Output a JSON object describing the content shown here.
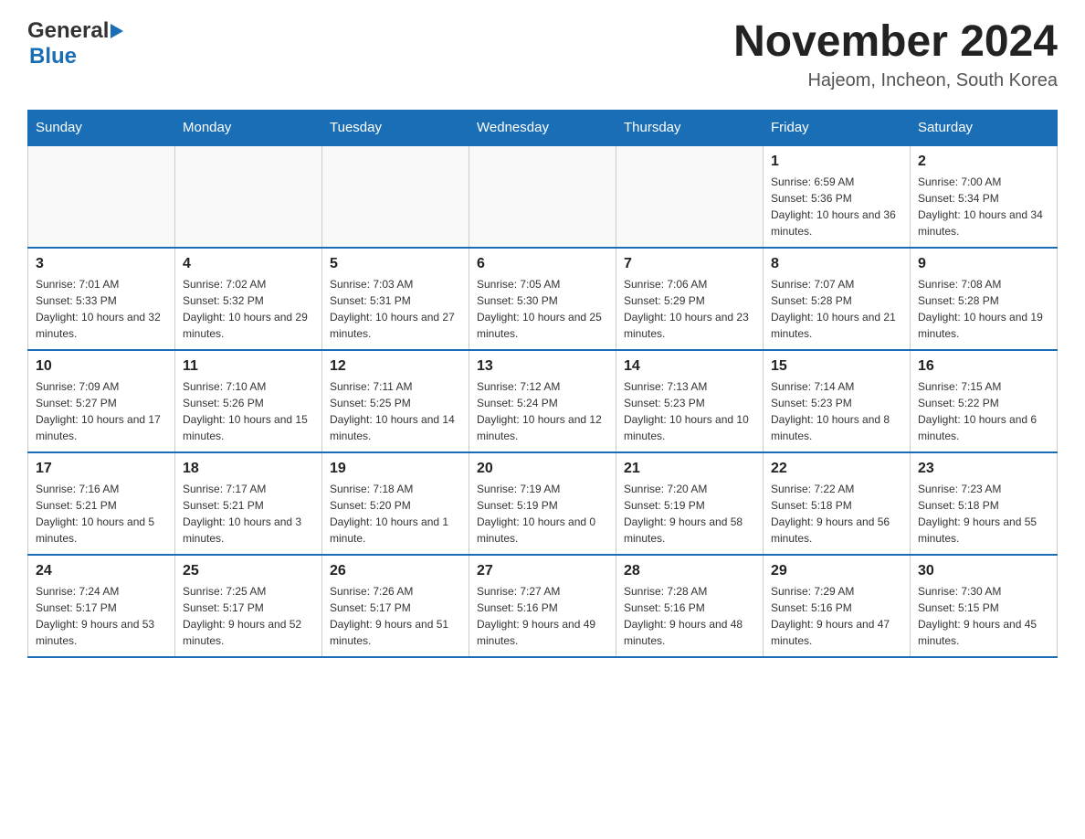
{
  "header": {
    "logo_general": "General",
    "logo_blue": "Blue",
    "title": "November 2024",
    "location": "Hajeom, Incheon, South Korea"
  },
  "days_of_week": [
    "Sunday",
    "Monday",
    "Tuesday",
    "Wednesday",
    "Thursday",
    "Friday",
    "Saturday"
  ],
  "weeks": [
    [
      {
        "day": "",
        "sunrise": "",
        "sunset": "",
        "daylight": ""
      },
      {
        "day": "",
        "sunrise": "",
        "sunset": "",
        "daylight": ""
      },
      {
        "day": "",
        "sunrise": "",
        "sunset": "",
        "daylight": ""
      },
      {
        "day": "",
        "sunrise": "",
        "sunset": "",
        "daylight": ""
      },
      {
        "day": "",
        "sunrise": "",
        "sunset": "",
        "daylight": ""
      },
      {
        "day": "1",
        "sunrise": "Sunrise: 6:59 AM",
        "sunset": "Sunset: 5:36 PM",
        "daylight": "Daylight: 10 hours and 36 minutes."
      },
      {
        "day": "2",
        "sunrise": "Sunrise: 7:00 AM",
        "sunset": "Sunset: 5:34 PM",
        "daylight": "Daylight: 10 hours and 34 minutes."
      }
    ],
    [
      {
        "day": "3",
        "sunrise": "Sunrise: 7:01 AM",
        "sunset": "Sunset: 5:33 PM",
        "daylight": "Daylight: 10 hours and 32 minutes."
      },
      {
        "day": "4",
        "sunrise": "Sunrise: 7:02 AM",
        "sunset": "Sunset: 5:32 PM",
        "daylight": "Daylight: 10 hours and 29 minutes."
      },
      {
        "day": "5",
        "sunrise": "Sunrise: 7:03 AM",
        "sunset": "Sunset: 5:31 PM",
        "daylight": "Daylight: 10 hours and 27 minutes."
      },
      {
        "day": "6",
        "sunrise": "Sunrise: 7:05 AM",
        "sunset": "Sunset: 5:30 PM",
        "daylight": "Daylight: 10 hours and 25 minutes."
      },
      {
        "day": "7",
        "sunrise": "Sunrise: 7:06 AM",
        "sunset": "Sunset: 5:29 PM",
        "daylight": "Daylight: 10 hours and 23 minutes."
      },
      {
        "day": "8",
        "sunrise": "Sunrise: 7:07 AM",
        "sunset": "Sunset: 5:28 PM",
        "daylight": "Daylight: 10 hours and 21 minutes."
      },
      {
        "day": "9",
        "sunrise": "Sunrise: 7:08 AM",
        "sunset": "Sunset: 5:28 PM",
        "daylight": "Daylight: 10 hours and 19 minutes."
      }
    ],
    [
      {
        "day": "10",
        "sunrise": "Sunrise: 7:09 AM",
        "sunset": "Sunset: 5:27 PM",
        "daylight": "Daylight: 10 hours and 17 minutes."
      },
      {
        "day": "11",
        "sunrise": "Sunrise: 7:10 AM",
        "sunset": "Sunset: 5:26 PM",
        "daylight": "Daylight: 10 hours and 15 minutes."
      },
      {
        "day": "12",
        "sunrise": "Sunrise: 7:11 AM",
        "sunset": "Sunset: 5:25 PM",
        "daylight": "Daylight: 10 hours and 14 minutes."
      },
      {
        "day": "13",
        "sunrise": "Sunrise: 7:12 AM",
        "sunset": "Sunset: 5:24 PM",
        "daylight": "Daylight: 10 hours and 12 minutes."
      },
      {
        "day": "14",
        "sunrise": "Sunrise: 7:13 AM",
        "sunset": "Sunset: 5:23 PM",
        "daylight": "Daylight: 10 hours and 10 minutes."
      },
      {
        "day": "15",
        "sunrise": "Sunrise: 7:14 AM",
        "sunset": "Sunset: 5:23 PM",
        "daylight": "Daylight: 10 hours and 8 minutes."
      },
      {
        "day": "16",
        "sunrise": "Sunrise: 7:15 AM",
        "sunset": "Sunset: 5:22 PM",
        "daylight": "Daylight: 10 hours and 6 minutes."
      }
    ],
    [
      {
        "day": "17",
        "sunrise": "Sunrise: 7:16 AM",
        "sunset": "Sunset: 5:21 PM",
        "daylight": "Daylight: 10 hours and 5 minutes."
      },
      {
        "day": "18",
        "sunrise": "Sunrise: 7:17 AM",
        "sunset": "Sunset: 5:21 PM",
        "daylight": "Daylight: 10 hours and 3 minutes."
      },
      {
        "day": "19",
        "sunrise": "Sunrise: 7:18 AM",
        "sunset": "Sunset: 5:20 PM",
        "daylight": "Daylight: 10 hours and 1 minute."
      },
      {
        "day": "20",
        "sunrise": "Sunrise: 7:19 AM",
        "sunset": "Sunset: 5:19 PM",
        "daylight": "Daylight: 10 hours and 0 minutes."
      },
      {
        "day": "21",
        "sunrise": "Sunrise: 7:20 AM",
        "sunset": "Sunset: 5:19 PM",
        "daylight": "Daylight: 9 hours and 58 minutes."
      },
      {
        "day": "22",
        "sunrise": "Sunrise: 7:22 AM",
        "sunset": "Sunset: 5:18 PM",
        "daylight": "Daylight: 9 hours and 56 minutes."
      },
      {
        "day": "23",
        "sunrise": "Sunrise: 7:23 AM",
        "sunset": "Sunset: 5:18 PM",
        "daylight": "Daylight: 9 hours and 55 minutes."
      }
    ],
    [
      {
        "day": "24",
        "sunrise": "Sunrise: 7:24 AM",
        "sunset": "Sunset: 5:17 PM",
        "daylight": "Daylight: 9 hours and 53 minutes."
      },
      {
        "day": "25",
        "sunrise": "Sunrise: 7:25 AM",
        "sunset": "Sunset: 5:17 PM",
        "daylight": "Daylight: 9 hours and 52 minutes."
      },
      {
        "day": "26",
        "sunrise": "Sunrise: 7:26 AM",
        "sunset": "Sunset: 5:17 PM",
        "daylight": "Daylight: 9 hours and 51 minutes."
      },
      {
        "day": "27",
        "sunrise": "Sunrise: 7:27 AM",
        "sunset": "Sunset: 5:16 PM",
        "daylight": "Daylight: 9 hours and 49 minutes."
      },
      {
        "day": "28",
        "sunrise": "Sunrise: 7:28 AM",
        "sunset": "Sunset: 5:16 PM",
        "daylight": "Daylight: 9 hours and 48 minutes."
      },
      {
        "day": "29",
        "sunrise": "Sunrise: 7:29 AM",
        "sunset": "Sunset: 5:16 PM",
        "daylight": "Daylight: 9 hours and 47 minutes."
      },
      {
        "day": "30",
        "sunrise": "Sunrise: 7:30 AM",
        "sunset": "Sunset: 5:15 PM",
        "daylight": "Daylight: 9 hours and 45 minutes."
      }
    ]
  ]
}
